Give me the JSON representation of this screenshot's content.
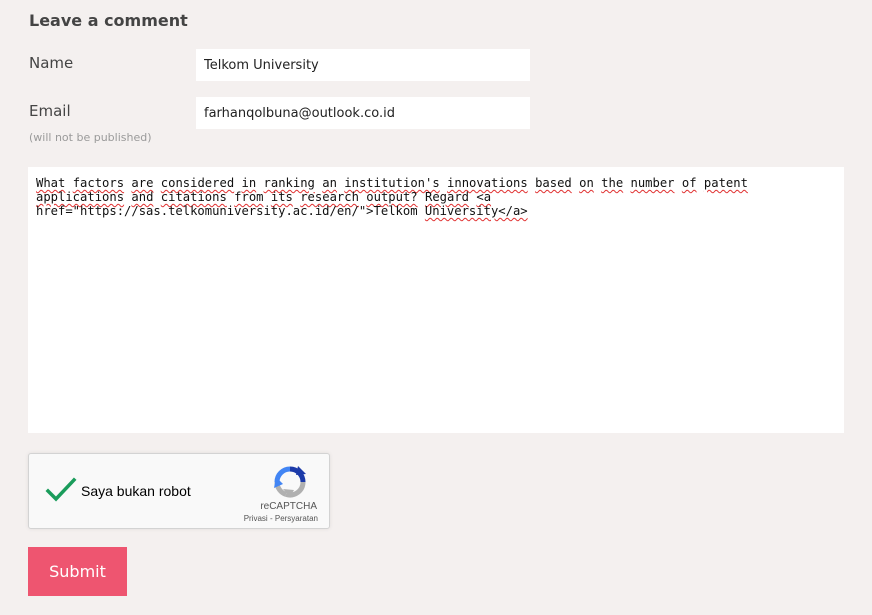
{
  "form": {
    "heading": "Leave a comment",
    "name_label": "Name",
    "name_value": "Telkom University",
    "email_label": "Email",
    "email_hint": "(will not be published)",
    "email_value": "farhanqolbuna@outlook.co.id",
    "comment_words": [
      "What",
      "factors",
      "are",
      "considered",
      "in",
      "ranking",
      "an",
      "institution's",
      "innovations",
      "based",
      "on",
      "the",
      "number",
      "of",
      "patent",
      "applications",
      "and",
      "citations",
      "from",
      "its",
      "research",
      "output?",
      "Regard",
      "<a",
      "href=\"https://sas.telkomuniversity.ac.id/en/\">Telkom",
      "University</a>"
    ],
    "submit_label": "Submit"
  },
  "captcha": {
    "label": "Saya bukan robot",
    "brand": "reCAPTCHA",
    "privacy": "Privasi",
    "separator": "-",
    "terms": "Persyaratan",
    "check_color": "#1a9c5b"
  },
  "colors": {
    "background": "#f4f0ef",
    "submit": "#ee5570"
  }
}
